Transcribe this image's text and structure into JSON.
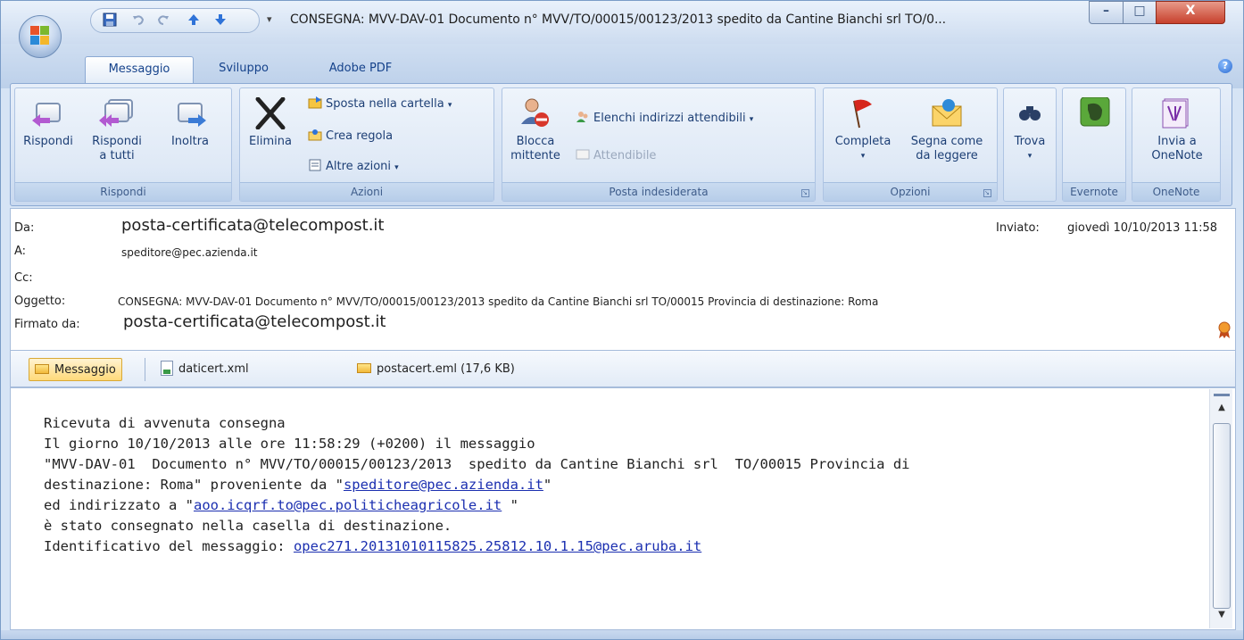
{
  "window": {
    "title": "CONSEGNA: MVV-DAV-01  Documento n° MVV/TO/00015/00123/2013  spedito da Cantine Bianchi srl  TO/0...",
    "minimize_glyph": "–",
    "maximize_glyph": "□",
    "close_glyph": "X"
  },
  "quick_access": {
    "icons": [
      "save-icon",
      "undo-icon",
      "redo-icon",
      "previous-item-icon",
      "next-item-icon"
    ],
    "customize_glyph": "▾"
  },
  "tabs": [
    {
      "label": "Messaggio",
      "active": true
    },
    {
      "label": "Sviluppo",
      "active": false
    },
    {
      "label": "Adobe PDF",
      "active": false
    }
  ],
  "ribbon": {
    "groups": {
      "rispondi": {
        "label": "Rispondi",
        "reply": "Rispondi",
        "reply_all_line1": "Rispondi",
        "reply_all_line2": "a tutti",
        "forward": "Inoltra"
      },
      "azioni": {
        "label": "Azioni",
        "delete": "Elimina",
        "move": "Sposta nella cartella",
        "create_rule": "Crea regola",
        "other_actions": "Altre azioni"
      },
      "posta_indesiderata": {
        "label": "Posta indesiderata",
        "block_line1": "Blocca",
        "block_line2": "mittente",
        "safe_lists": "Elenchi indirizzi attendibili",
        "not_junk": "Attendibile"
      },
      "opzioni": {
        "label": "Opzioni",
        "complete": "Completa",
        "mark_unread_line1": "Segna come",
        "mark_unread_line2": "da leggere"
      },
      "trova": {
        "find": "Trova"
      },
      "evernote": {
        "label": "Evernote"
      },
      "onenote": {
        "label": "OneNote",
        "send_line1": "Invia a",
        "send_line2": "OneNote"
      }
    }
  },
  "header": {
    "from_label": "Da:",
    "from_value": "posta-certificata@telecompost.it",
    "to_label": "A:",
    "to_value": "speditore@pec.azienda.it",
    "cc_label": "Cc:",
    "subject_label": "Oggetto:",
    "subject_value": "CONSEGNA: MVV-DAV-01  Documento n° MVV/TO/00015/00123/2013  spedito da Cantine Bianchi srl  TO/00015 Provincia di destinazione: Roma",
    "signed_label": "Firmato da:",
    "signed_value": "posta-certificata@telecompost.it",
    "sent_label": "Inviato:",
    "sent_value": "giovedì 10/10/2013 11:58"
  },
  "attachments": [
    {
      "label": "Messaggio",
      "icon": "envelope-icon"
    },
    {
      "label": "daticert.xml",
      "icon": "xml-file-icon"
    },
    {
      "label": "postacert.eml (17,6 KB)",
      "icon": "envelope-icon"
    }
  ],
  "body": {
    "line1": "Ricevuta di avvenuta consegna",
    "line2": "Il giorno 10/10/2013 alle ore 11:58:29 (+0200) il messaggio",
    "line3": "\"MVV-DAV-01  Documento n° MVV/TO/00015/00123/2013  spedito da Cantine Bianchi srl  TO/00015 Provincia di",
    "line4_prefix": "destinazione: Roma\" proveniente da \"",
    "line4_link": "speditore@pec.azienda.it",
    "line4_suffix": "\"",
    "line5_prefix": "ed indirizzato a \"",
    "line5_link": "aoo.icqrf.to@pec.politicheagricole.it",
    "line5_suffix": " \"",
    "line6": "è stato consegnato nella casella di destinazione.",
    "line7_prefix": "Identificativo del messaggio: ",
    "line7_link": "opec271.20131010115825.25812.10.1.15@pec.aruba.it"
  }
}
